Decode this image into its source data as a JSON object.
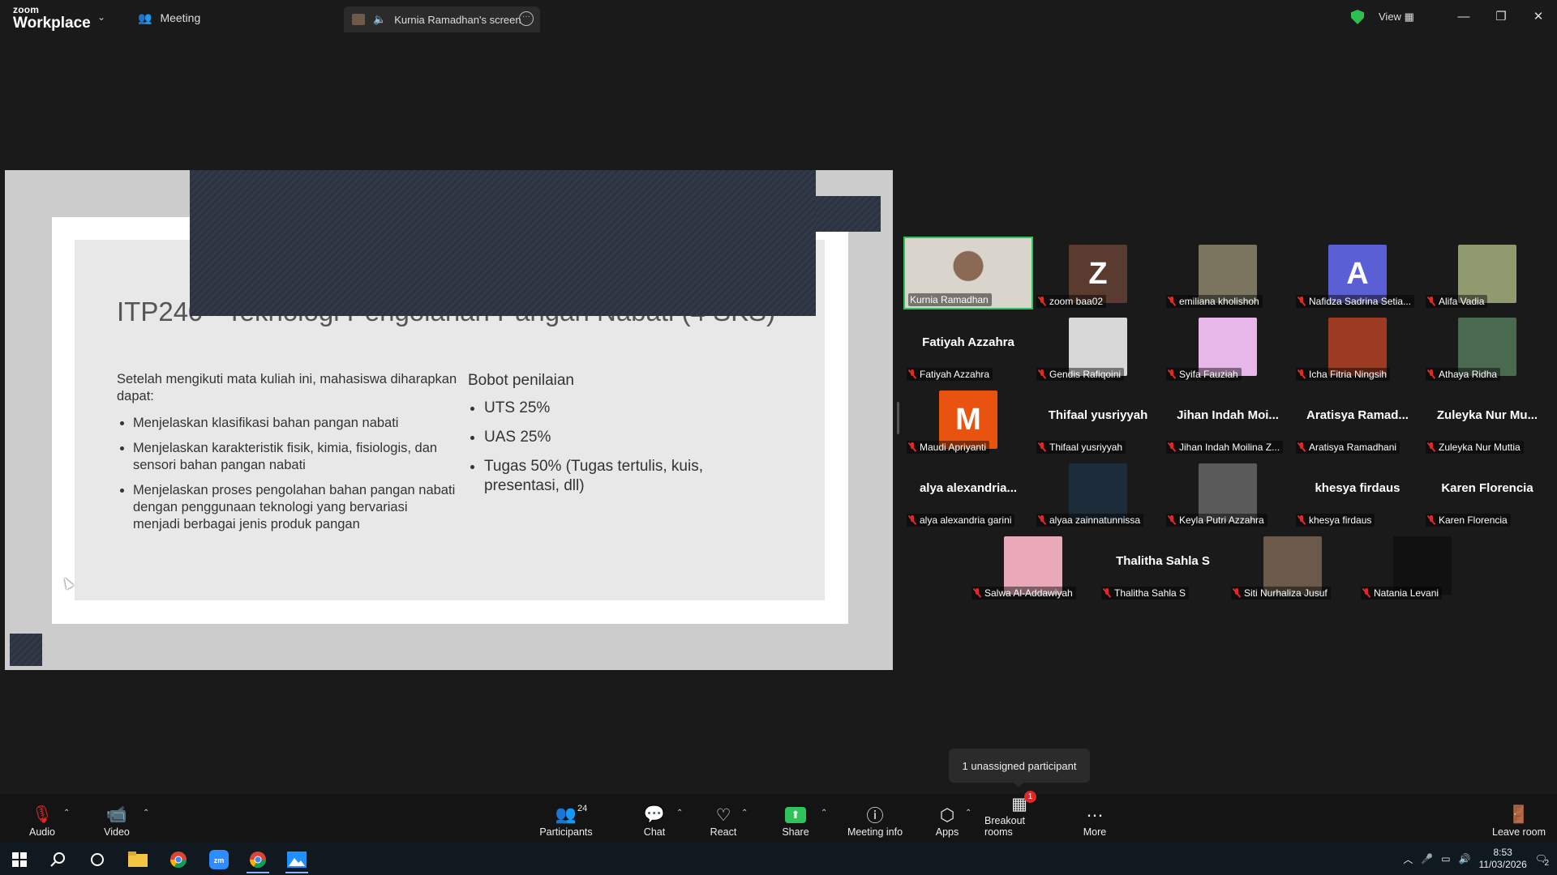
{
  "app": {
    "brand_line1": "zoom",
    "brand_line2": "Workplace",
    "meeting_tab": "Meeting",
    "screen_tab": "Kurnia Ramadhan's screen",
    "view_label": "View"
  },
  "slide": {
    "title": "ITP240 - Teknologi Pengolahan Pangan Nabati (4 SKS)",
    "intro": "Setelah mengikuti mata kuliah ini, mahasiswa diharapkan dapat:",
    "objectives": [
      "Menjelaskan klasifikasi bahan pangan nabati",
      "Menjelaskan karakteristik fisik, kimia, fisiologis, dan sensori bahan pangan nabati",
      "Menjelaskan proses pengolahan bahan pangan nabati dengan penggunaan teknologi yang bervariasi menjadi berbagai jenis produk pangan"
    ],
    "grading_title": "Bobot penilaian",
    "grading": [
      "UTS 25%",
      "UAS 25%",
      "Tugas 50% (Tugas tertulis, kuis, presentasi, dll)"
    ]
  },
  "participants": [
    {
      "label": "Kurnia Ramadhan",
      "big": "",
      "avatar": "",
      "color": "",
      "muted": false,
      "speaking": true
    },
    {
      "label": "zoom baa02",
      "big": "",
      "avatar": "Z",
      "color": "#5a3b30",
      "muted": true
    },
    {
      "label": "emiliana kholishoh",
      "big": "",
      "avatar": "",
      "color": "#7b7560",
      "muted": true
    },
    {
      "label": "Nafidza Sadrina Setia...",
      "big": "",
      "avatar": "A",
      "color": "#5b5fd6",
      "muted": true
    },
    {
      "label": "Alifa Vadia",
      "big": "",
      "avatar": "",
      "color": "#8f9a6e",
      "muted": true
    },
    {
      "label": "Fatiyah Azzahra",
      "big": "Fatiyah Azzahra",
      "avatar": "",
      "color": "",
      "muted": true
    },
    {
      "label": "Gendis Rafiqoini",
      "big": "",
      "avatar": "",
      "color": "#d8d8d8",
      "muted": true
    },
    {
      "label": "Syifa Fauziah",
      "big": "",
      "avatar": "",
      "color": "#e6b7e8",
      "muted": true
    },
    {
      "label": "Icha Fitria Ningsih",
      "big": "",
      "avatar": "",
      "color": "#9c3a22",
      "muted": true
    },
    {
      "label": "Athaya Ridha",
      "big": "",
      "avatar": "",
      "color": "#4a6a50",
      "muted": true
    },
    {
      "label": "Maudi Apriyanti",
      "big": "",
      "avatar": "M",
      "color": "#e8530f",
      "muted": true
    },
    {
      "label": "Thifaal yusriyyah",
      "big": "Thifaal yusriyyah",
      "avatar": "",
      "color": "",
      "muted": true
    },
    {
      "label": "Jihan Indah Moilina Z...",
      "big": "Jihan Indah Moi...",
      "avatar": "",
      "color": "",
      "muted": true
    },
    {
      "label": "Aratisya Ramadhani",
      "big": "Aratisya Ramad...",
      "avatar": "",
      "color": "",
      "muted": true
    },
    {
      "label": "Zuleyka Nur Muttia",
      "big": "Zuleyka Nur Mu...",
      "avatar": "",
      "color": "",
      "muted": true
    },
    {
      "label": "alya alexandria garini",
      "big": "alya alexandria...",
      "avatar": "",
      "color": "",
      "muted": true
    },
    {
      "label": "alyaa zainnatunnissa",
      "big": "",
      "avatar": "",
      "color": "#1d2c3a",
      "muted": true
    },
    {
      "label": "Keyla Putri Azzahra",
      "big": "",
      "avatar": "",
      "color": "#5a5a5a",
      "muted": true
    },
    {
      "label": "khesya firdaus",
      "big": "khesya firdaus",
      "avatar": "",
      "color": "",
      "muted": true
    },
    {
      "label": "Karen Florencia",
      "big": "Karen Florencia",
      "avatar": "",
      "color": "",
      "muted": true
    },
    {
      "label": "Salwa Al-Addawiyah",
      "big": "",
      "avatar": "",
      "color": "#e9a9b8",
      "muted": true
    },
    {
      "label": "Thalitha Sahla S",
      "big": "Thalitha Sahla S",
      "avatar": "",
      "color": "",
      "muted": true
    },
    {
      "label": "Siti Nurhaliza Jusuf",
      "big": "",
      "avatar": "",
      "color": "#6b5a4c",
      "muted": true
    },
    {
      "label": "Natania Levani",
      "big": "",
      "avatar": "",
      "color": "#111111",
      "muted": true
    }
  ],
  "tooltip": "1 unassigned participant",
  "toolbar": {
    "audio": "Audio",
    "video": "Video",
    "participants": "Participants",
    "participants_count": "24",
    "chat": "Chat",
    "react": "React",
    "share": "Share",
    "meeting_info": "Meeting info",
    "apps": "Apps",
    "breakout_rooms": "Breakout rooms",
    "breakout_badge": "1",
    "more": "More",
    "leave_room": "Leave room"
  },
  "taskbar": {
    "time": "8:53",
    "date": "11/03/2026",
    "notif_count": "2"
  },
  "icons": [
    "windows-start-icon",
    "search-icon",
    "cortana-icon",
    "file-explorer-icon",
    "chrome-icon",
    "zoom-icon",
    "chrome-active-icon",
    "photos-icon"
  ]
}
